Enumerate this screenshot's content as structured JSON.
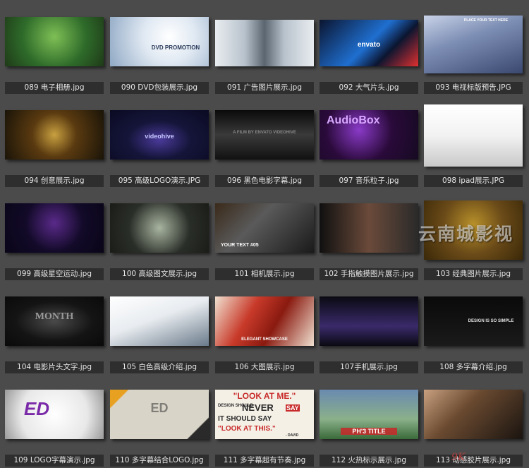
{
  "watermark": "云南城影视",
  "corner_mark": "9K",
  "items": [
    {
      "label": "089 电子相册.jpg",
      "theme": "garden",
      "colors": [
        "#2e6b2a",
        "#7fbf55",
        "#1f3a18"
      ],
      "overlay": ""
    },
    {
      "label": "090 DVD包装展示.jpg",
      "theme": "dvd",
      "colors": [
        "#dfe8f2",
        "#8fa8c4",
        "#ffffff"
      ],
      "overlay": "DVD PROMOTION"
    },
    {
      "label": "091 广告图片展示.jpg",
      "theme": "ad",
      "colors": [
        "#e9edf0",
        "#b8c2cc",
        "#5a6570"
      ],
      "overlay": ""
    },
    {
      "label": "092 大气片头.jpg",
      "theme": "techno",
      "colors": [
        "#0b1530",
        "#1f6fd0",
        "#e03030"
      ],
      "overlay": "envato"
    },
    {
      "label": "093 电视标版预告.JPG",
      "theme": "tv",
      "colors": [
        "#c9d3e8",
        "#3a4870",
        "#7e8fb5"
      ],
      "overlay": "PLACE YOUR TEXT HERE"
    },
    {
      "label": "094 创意展示.jpg",
      "theme": "grunge",
      "colors": [
        "#1a1408",
        "#c8a040",
        "#5a3a10"
      ],
      "overlay": ""
    },
    {
      "label": "095 高级LOGO演示.JPG",
      "theme": "logo",
      "colors": [
        "#0a0a22",
        "#4a3a9a",
        "#15153a"
      ],
      "overlay": "videohive"
    },
    {
      "label": "096 黑色电影字幕.jpg",
      "theme": "film",
      "colors": [
        "#111111",
        "#3a3a3a",
        "#0a0a0a"
      ],
      "overlay": "A FILM BY ENVATO VIDEOHIVE"
    },
    {
      "label": "097 音乐粒子.jpg",
      "theme": "audio",
      "colors": [
        "#160a22",
        "#8a3ac8",
        "#2a0a3a"
      ],
      "overlay": "AudioBox"
    },
    {
      "label": "098 ipad展示.JPG",
      "theme": "ipad",
      "colors": [
        "#f2f2f2",
        "#c8c8c8",
        "#ffffff"
      ],
      "overlay": ""
    },
    {
      "label": "099 高级星空运动.jpg",
      "theme": "stars",
      "colors": [
        "#120a28",
        "#5a2a8a",
        "#0a0518"
      ],
      "overlay": ""
    },
    {
      "label": "100 高级图文展示.jpg",
      "theme": "photos",
      "colors": [
        "#2a2e28",
        "#a8b4a0",
        "#1a1c18"
      ],
      "overlay": ""
    },
    {
      "label": "101 相机展示.jpg",
      "theme": "camera",
      "colors": [
        "#1a1a1a",
        "#5a5a5a",
        "#3a2a1a"
      ],
      "overlay": "YOUR TEXT #05"
    },
    {
      "label": "102 手指触摸图片展示.jpg",
      "theme": "touch",
      "colors": [
        "#101010",
        "#6a4a3a",
        "#2a2a2a"
      ],
      "overlay": ""
    },
    {
      "label": "103 经典图片展示.jpg",
      "theme": "classic",
      "colors": [
        "#3a2808",
        "#b8902a",
        "#6a4a18"
      ],
      "overlay": ""
    },
    {
      "label": "104 电影片头文字.jpg",
      "theme": "movie",
      "colors": [
        "#141414",
        "#4a4a4a",
        "#0a0a0a"
      ],
      "overlay": "MONTH"
    },
    {
      "label": "105 白色高级介绍.jpg",
      "theme": "white",
      "colors": [
        "#e8ecf0",
        "#6a7a8a",
        "#ffffff"
      ],
      "overlay": ""
    },
    {
      "label": "106 大图展示.jpg",
      "theme": "bigpic",
      "colors": [
        "#c83a2a",
        "#f0e0d0",
        "#8a1a10"
      ],
      "overlay": "ELEGANT SHOWCASE"
    },
    {
      "label": "107手机展示.jpg",
      "theme": "phone",
      "colors": [
        "#0a0a12",
        "#b8b8c8",
        "#3a2a6a"
      ],
      "overlay": ""
    },
    {
      "label": "108 多字幕介绍.jpg",
      "theme": "quotes",
      "colors": [
        "#0a0a0a",
        "#c83a3a",
        "#e0e0e0"
      ],
      "overlay": "DESIGN IS SO SIMPLE"
    },
    {
      "label": "109 LOGO字幕演示.jpg",
      "theme": "ed",
      "colors": [
        "#e8e8e8",
        "#7a2aa8",
        "#ffffff"
      ],
      "overlay": "ED"
    },
    {
      "label": "110 多字幕结合LOGO.jpg",
      "theme": "paper",
      "colors": [
        "#d8d4c8",
        "#2a2a2a",
        "#e8a020"
      ],
      "overlay": "ED"
    },
    {
      "label": "111 多字幕超有节奏.jpg",
      "theme": "typo",
      "colors": [
        "#f4f0e6",
        "#c82a2a",
        "#2a2a2a"
      ],
      "overlay": "\"LOOK AT ME.\""
    },
    {
      "label": "112 火热标示展示.jpg",
      "theme": "baseball",
      "colors": [
        "#6a8ab0",
        "#c82a2a",
        "#f0f0f0"
      ],
      "overlay": "PH'3 TITLE"
    },
    {
      "label": "113 动感胶片展示.jpg",
      "theme": "filmstrip",
      "colors": [
        "#1a1410",
        "#c8a080",
        "#6a4a30"
      ],
      "overlay": ""
    }
  ]
}
